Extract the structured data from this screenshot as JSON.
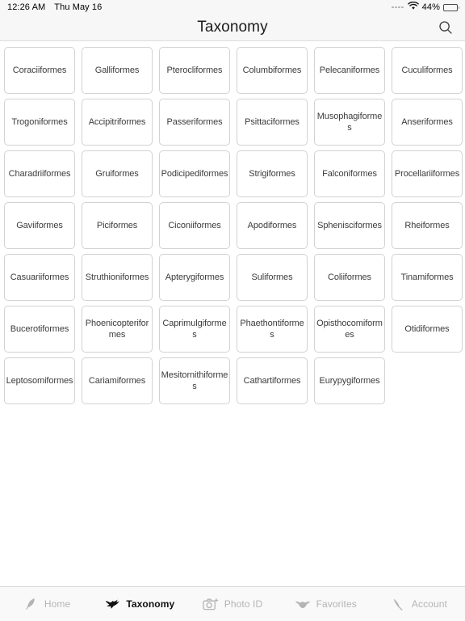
{
  "status_bar": {
    "time": "12:26 AM",
    "date": "Thu May 16",
    "signal_icon": "signal-dots-icon",
    "wifi_icon": "wifi-icon",
    "battery_percent": "44%",
    "battery_icon": "battery-icon",
    "battery_level": 44
  },
  "nav": {
    "title": "Taxonomy",
    "search_icon": "search-icon"
  },
  "colors": {
    "bar_background": "#f7f7f7",
    "card_border": "#d2d2d2",
    "text": "#3c3c3c",
    "inactive_tab": "#b4b4b4",
    "active_tab": "#111111"
  },
  "grid": {
    "columns": 6,
    "items": [
      {
        "label": "Coraciiformes"
      },
      {
        "label": "Galliformes"
      },
      {
        "label": "Pterocliformes"
      },
      {
        "label": "Columbiformes"
      },
      {
        "label": "Pelecaniformes"
      },
      {
        "label": "Cuculiformes"
      },
      {
        "label": "Trogoniformes"
      },
      {
        "label": "Accipitriformes"
      },
      {
        "label": "Passeriformes"
      },
      {
        "label": "Psittaciformes"
      },
      {
        "label": "Musophagiformes"
      },
      {
        "label": "Anseriformes"
      },
      {
        "label": "Charadriiformes"
      },
      {
        "label": "Gruiformes"
      },
      {
        "label": "Podicipediformes"
      },
      {
        "label": "Strigiformes"
      },
      {
        "label": "Falconiformes"
      },
      {
        "label": "Procellariiformes"
      },
      {
        "label": "Gaviiformes"
      },
      {
        "label": "Piciformes"
      },
      {
        "label": "Ciconiiformes"
      },
      {
        "label": "Apodiformes"
      },
      {
        "label": "Sphenisciformes"
      },
      {
        "label": "Rheiformes"
      },
      {
        "label": "Casuariiformes"
      },
      {
        "label": "Struthioniformes"
      },
      {
        "label": "Apterygiformes"
      },
      {
        "label": "Suliformes"
      },
      {
        "label": "Coliiformes"
      },
      {
        "label": "Tinamiformes"
      },
      {
        "label": "Bucerotiformes"
      },
      {
        "label": "Phoenicopteriformes"
      },
      {
        "label": "Caprimulgiformes"
      },
      {
        "label": "Phaethontiformes"
      },
      {
        "label": "Opisthocomiformes"
      },
      {
        "label": "Otidiformes"
      },
      {
        "label": "Leptosomiformes"
      },
      {
        "label": "Cariamiformes"
      },
      {
        "label": "Mesitornithiformes"
      },
      {
        "label": "Cathartiformes"
      },
      {
        "label": "Eurypygiformes"
      }
    ]
  },
  "tab_bar": {
    "items": [
      {
        "label": "Home",
        "icon": "feather-icon",
        "active": false
      },
      {
        "label": "Taxonomy",
        "icon": "bird-icon",
        "active": true
      },
      {
        "label": "Photo ID",
        "icon": "camera-plus-icon",
        "active": false
      },
      {
        "label": "Favorites",
        "icon": "bird-wings-icon",
        "active": false
      },
      {
        "label": "Account",
        "icon": "quill-icon",
        "active": false
      }
    ]
  }
}
